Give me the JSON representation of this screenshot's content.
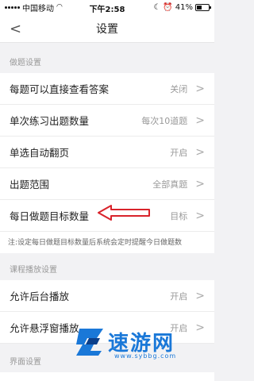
{
  "status_bar": {
    "carrier": "中国移动",
    "time": "下午2:58",
    "battery": "41%"
  },
  "nav": {
    "title": "设置"
  },
  "sections": [
    {
      "header": "做题设置",
      "rows": [
        {
          "label": "每题可以直接查看答案",
          "value": "关闭"
        },
        {
          "label": "单次练习出题数量",
          "value": "每次10道题"
        },
        {
          "label": "单选自动翻页",
          "value": "开启"
        },
        {
          "label": "出题范围",
          "value": "全部真题"
        },
        {
          "label": "每日做题目标数量",
          "value": "目标"
        }
      ],
      "note": "注:设定每日做题目标数量后系统会定时提醒今日做题数"
    },
    {
      "header": "课程播放设置",
      "rows": [
        {
          "label": "允许后台播放",
          "value": "开启"
        },
        {
          "label": "允许悬浮窗播放",
          "value": "开启"
        }
      ]
    },
    {
      "header": "界面设置",
      "rows": []
    }
  ],
  "watermark": {
    "name": "速游网",
    "url": "www.sybbg.com"
  },
  "colors": {
    "accent": "#1a78d8",
    "annotation": "#d9232b"
  },
  "icons": [
    "back-icon",
    "chevron-right-icon",
    "wifi-icon",
    "signal-icon",
    "battery-icon"
  ]
}
